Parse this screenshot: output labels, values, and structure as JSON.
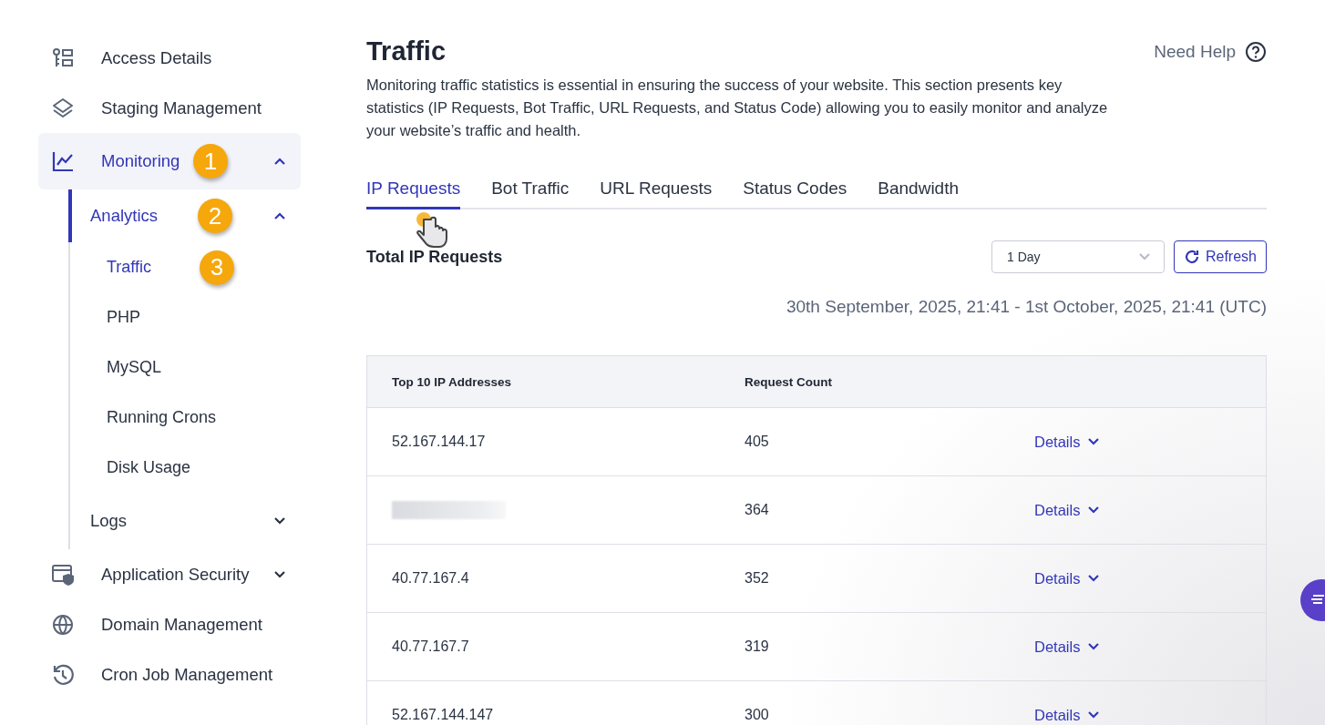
{
  "sidebar": {
    "items": [
      {
        "kind": "link",
        "label": "Access Details",
        "selected": false
      },
      {
        "kind": "link",
        "label": "Staging Management",
        "selected": false
      },
      {
        "kind": "group",
        "label": "Monitoring",
        "selected": true,
        "expanded": true,
        "badge": "1",
        "children": [
          {
            "kind": "group",
            "label": "Analytics",
            "selected": true,
            "expanded": true,
            "badge": "2",
            "children": [
              {
                "label": "Traffic",
                "selected": true,
                "badge": "3"
              },
              {
                "label": "PHP",
                "selected": false
              },
              {
                "label": "MySQL",
                "selected": false
              },
              {
                "label": "Running Crons",
                "selected": false
              },
              {
                "label": "Disk Usage",
                "selected": false
              }
            ]
          },
          {
            "kind": "group",
            "label": "Logs",
            "selected": false,
            "expanded": false
          }
        ]
      },
      {
        "kind": "group",
        "label": "Application Security",
        "selected": false,
        "expanded": false
      },
      {
        "kind": "link",
        "label": "Domain Management",
        "selected": false
      },
      {
        "kind": "link",
        "label": "Cron Job Management",
        "selected": false
      }
    ]
  },
  "page": {
    "title": "Traffic",
    "help": "Need Help",
    "description": "Monitoring traffic statistics is essential in ensuring the success of your website. This section presents key statistics (IP Requests, Bot Traffic, URL Requests, and Status Code) allowing you to easily monitor and analyze your website’s traffic and health."
  },
  "tabs": [
    {
      "label": "IP Requests",
      "selected": true
    },
    {
      "label": "Bot Traffic",
      "selected": false
    },
    {
      "label": "URL Requests",
      "selected": false
    },
    {
      "label": "Status Codes",
      "selected": false
    },
    {
      "label": "Bandwidth",
      "selected": false
    }
  ],
  "section": {
    "title": "Total IP Requests",
    "period": "1 Day",
    "refresh": "Refresh",
    "range": "30th September, 2025, 21:41 - 1st October, 2025, 21:41 (UTC)"
  },
  "table": {
    "columns": [
      "Top 10 IP Addresses",
      "Request Count"
    ],
    "rows": [
      {
        "ip": "52.167.144.17",
        "redacted": false,
        "count": "405",
        "action": "Details"
      },
      {
        "redacted": true,
        "count": "364",
        "action": "Details"
      },
      {
        "ip": "40.77.167.4",
        "redacted": false,
        "count": "352",
        "action": "Details"
      },
      {
        "ip": "40.77.167.7",
        "redacted": false,
        "count": "319",
        "action": "Details"
      },
      {
        "ip": "52.167.144.147",
        "redacted": false,
        "count": "300",
        "action": "Details"
      }
    ]
  }
}
